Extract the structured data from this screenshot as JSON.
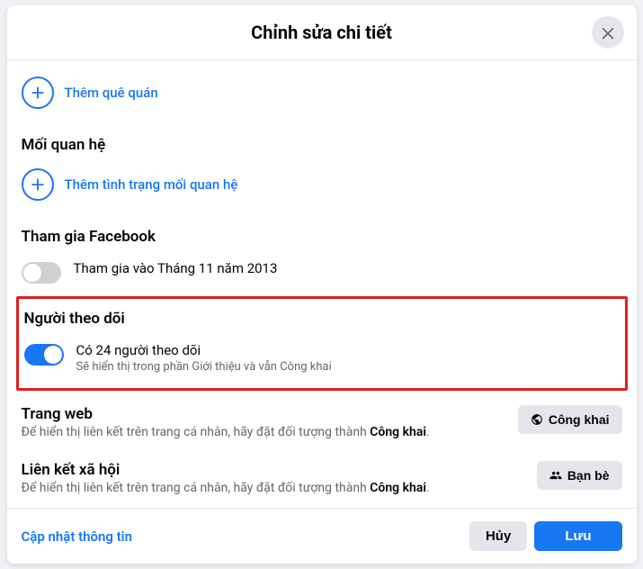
{
  "header": {
    "title": "Chỉnh sửa chi tiết"
  },
  "hometown": {
    "add_label": "Thêm quê quán"
  },
  "relationship": {
    "heading": "Mối quan hệ",
    "add_label": "Thêm tình trạng mối quan hệ"
  },
  "joined": {
    "heading": "Tham gia Facebook",
    "toggle_label": "Tham gia vào Tháng 11 năm 2013"
  },
  "followers": {
    "heading": "Người theo dõi",
    "toggle_title": "Có 24 người theo dõi",
    "toggle_subtitle": "Sẽ hiển thị trong phần Giới thiệu và vẫn Công khai"
  },
  "website": {
    "heading": "Trang web",
    "desc_prefix": "Để hiển thị liên kết trên trang cá nhân, hãy đặt đối tượng thành ",
    "desc_bold": "Công khai",
    "button_label": "Công khai"
  },
  "social": {
    "heading": "Liên kết xã hội",
    "desc_prefix": "Để hiển thị liên kết trên trang cá nhân, hãy đặt đối tượng thành ",
    "desc_bold": "Công khai",
    "button_label": "Bạn bè"
  },
  "footer": {
    "update_label": "Cập nhật thông tin",
    "cancel_label": "Hủy",
    "save_label": "Lưu"
  }
}
